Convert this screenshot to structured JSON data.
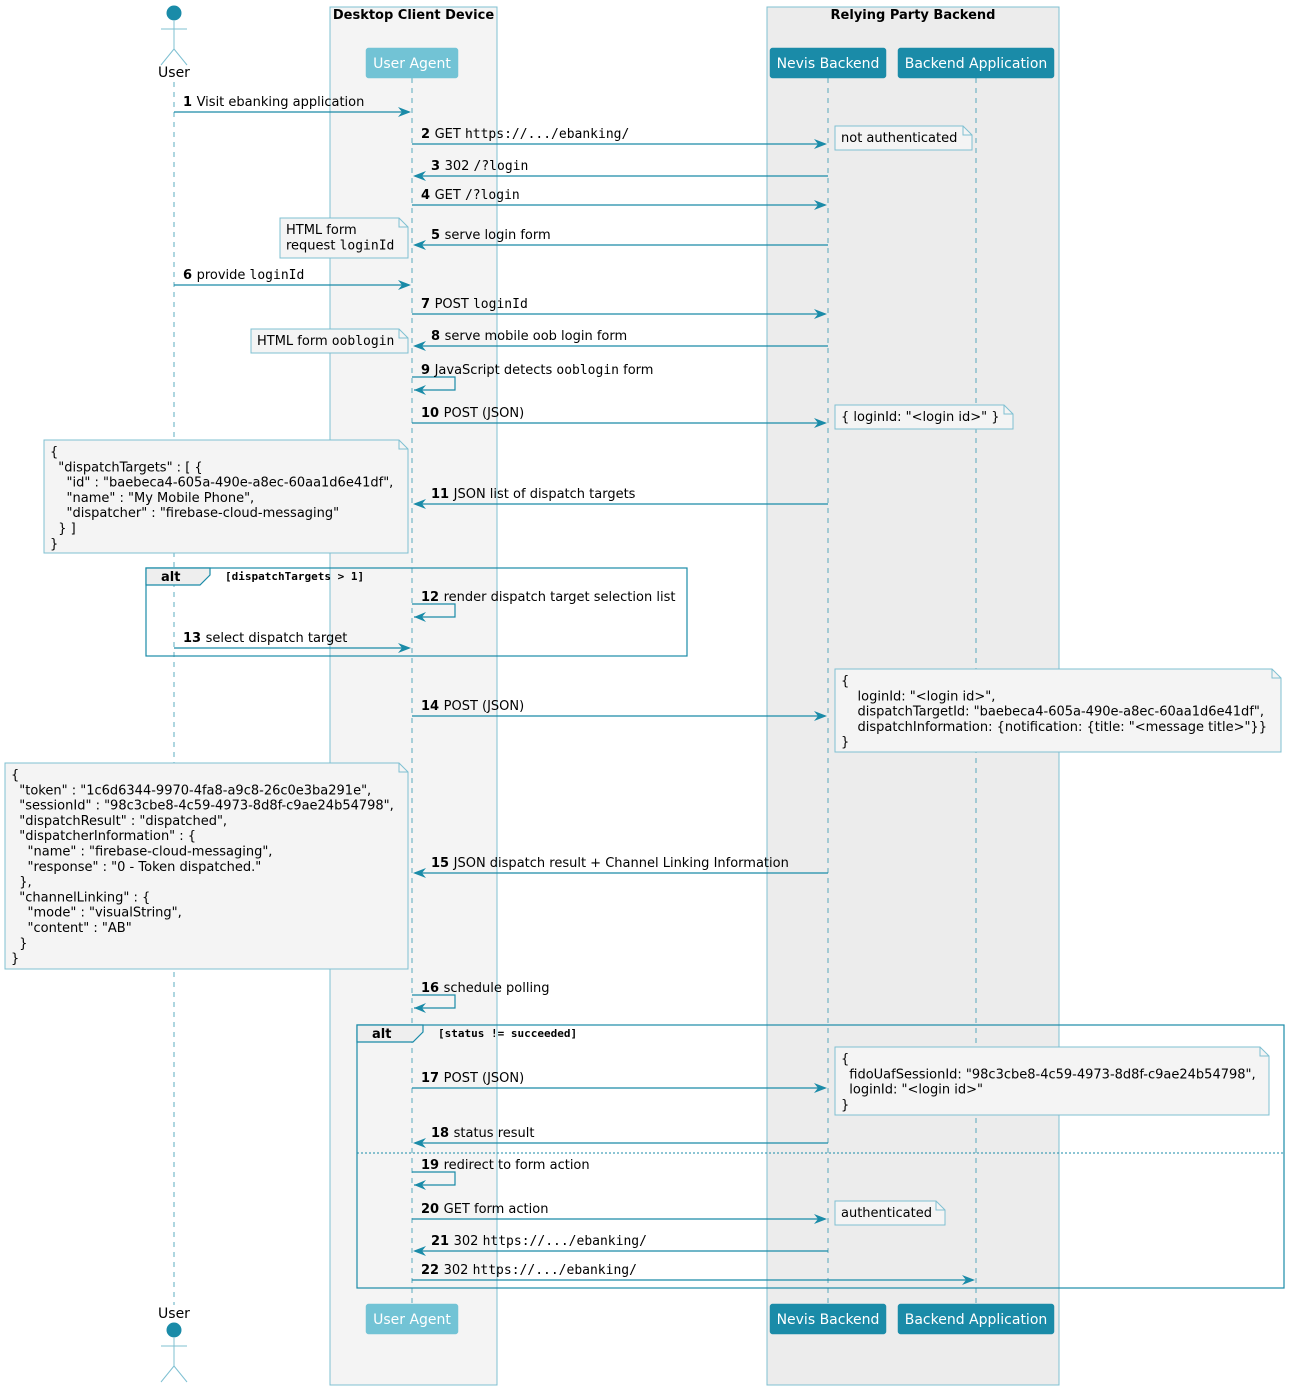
{
  "colors": {
    "line": "#1a8ba8",
    "box_border": "#7fc0d2",
    "desktop_box_fill": "#f4f4f4",
    "backend_box_fill": "#ececec",
    "user_agent_fill": "#72c3d5",
    "backend_fill": "#1a8ba8",
    "note_fill": "#f4f4f4",
    "note_border": "#7fc0d2",
    "actor_head": "#1a8ba8"
  },
  "boxes": [
    {
      "id": "desktop",
      "title": "Desktop Client Device"
    },
    {
      "id": "backend",
      "title": "Relying Party Backend"
    }
  ],
  "participants": [
    {
      "id": "user",
      "label": "User",
      "kind": "actor"
    },
    {
      "id": "ua",
      "label": "User Agent",
      "kind": "participant",
      "style": "light"
    },
    {
      "id": "nevis",
      "label": "Nevis Backend",
      "kind": "participant",
      "style": "dark"
    },
    {
      "id": "app",
      "label": "Backend Application",
      "kind": "participant",
      "style": "dark"
    }
  ],
  "messages": [
    {
      "n": "1",
      "from": "user",
      "to": "ua",
      "parts": [
        [
          "t",
          "Visit ebanking application"
        ]
      ]
    },
    {
      "n": "2",
      "from": "ua",
      "to": "nevis",
      "parts": [
        [
          "t",
          "GET "
        ],
        [
          "m",
          "https://.../ebanking/"
        ]
      ]
    },
    {
      "n": "3",
      "from": "nevis",
      "to": "ua",
      "parts": [
        [
          "t",
          "302 "
        ],
        [
          "m",
          "/?login"
        ]
      ]
    },
    {
      "n": "4",
      "from": "ua",
      "to": "nevis",
      "parts": [
        [
          "t",
          "GET "
        ],
        [
          "m",
          "/?login"
        ]
      ]
    },
    {
      "n": "5",
      "from": "nevis",
      "to": "ua",
      "parts": [
        [
          "t",
          "serve login form"
        ]
      ]
    },
    {
      "n": "6",
      "from": "user",
      "to": "ua",
      "parts": [
        [
          "t",
          "provide "
        ],
        [
          "m",
          "loginId"
        ]
      ]
    },
    {
      "n": "7",
      "from": "ua",
      "to": "nevis",
      "parts": [
        [
          "t",
          "POST "
        ],
        [
          "m",
          "loginId"
        ]
      ]
    },
    {
      "n": "8",
      "from": "nevis",
      "to": "ua",
      "parts": [
        [
          "t",
          "serve mobile oob login form"
        ]
      ]
    },
    {
      "n": "9",
      "from": "ua",
      "to": "ua",
      "parts": [
        [
          "t",
          "JavaScript detects "
        ],
        [
          "m",
          "ooblogin"
        ],
        [
          "t",
          " form"
        ]
      ]
    },
    {
      "n": "10",
      "from": "ua",
      "to": "nevis",
      "parts": [
        [
          "t",
          "POST (JSON)"
        ]
      ]
    },
    {
      "n": "11",
      "from": "nevis",
      "to": "ua",
      "parts": [
        [
          "t",
          "JSON list of dispatch targets"
        ]
      ]
    },
    {
      "n": "12",
      "from": "ua",
      "to": "ua",
      "parts": [
        [
          "t",
          "render dispatch target selection list"
        ]
      ]
    },
    {
      "n": "13",
      "from": "user",
      "to": "ua",
      "parts": [
        [
          "t",
          "select dispatch target"
        ]
      ]
    },
    {
      "n": "14",
      "from": "ua",
      "to": "nevis",
      "parts": [
        [
          "t",
          "POST (JSON)"
        ]
      ]
    },
    {
      "n": "15",
      "from": "nevis",
      "to": "ua",
      "parts": [
        [
          "t",
          "JSON dispatch result + Channel Linking Information"
        ]
      ]
    },
    {
      "n": "16",
      "from": "ua",
      "to": "ua",
      "parts": [
        [
          "t",
          "schedule polling"
        ]
      ]
    },
    {
      "n": "17",
      "from": "ua",
      "to": "nevis",
      "parts": [
        [
          "t",
          "POST (JSON)"
        ]
      ]
    },
    {
      "n": "18",
      "from": "nevis",
      "to": "ua",
      "parts": [
        [
          "t",
          "status result"
        ]
      ]
    },
    {
      "n": "19",
      "from": "ua",
      "to": "ua",
      "parts": [
        [
          "t",
          "redirect to form action"
        ]
      ]
    },
    {
      "n": "20",
      "from": "ua",
      "to": "nevis",
      "parts": [
        [
          "t",
          "GET form action"
        ]
      ]
    },
    {
      "n": "21",
      "from": "nevis",
      "to": "ua",
      "parts": [
        [
          "t",
          "302 "
        ],
        [
          "m",
          "https://.../ebanking/"
        ]
      ]
    },
    {
      "n": "22",
      "from": "ua",
      "to": "app",
      "parts": [
        [
          "t",
          "302 "
        ],
        [
          "m",
          "https://.../ebanking/"
        ]
      ]
    }
  ],
  "notes": [
    {
      "id": "note-not-authenticated",
      "at_message": "2",
      "side": "right",
      "lines": [
        [
          [
            "t",
            "not authenticated"
          ]
        ]
      ]
    },
    {
      "id": "note-html-form-loginid",
      "at_message": "5",
      "side": "left",
      "lines": [
        [
          [
            "t",
            "HTML form"
          ]
        ],
        [
          [
            "t",
            "request "
          ],
          [
            "m",
            "loginId"
          ]
        ]
      ]
    },
    {
      "id": "note-html-form-ooblogin",
      "at_message": "8",
      "side": "left",
      "lines": [
        [
          [
            "t",
            "HTML form "
          ],
          [
            "m",
            "ooblogin"
          ]
        ]
      ]
    },
    {
      "id": "note-loginid-json",
      "at_message": "10",
      "side": "right",
      "lines": [
        [
          [
            "t",
            "{ loginId: \"<login id>\" }"
          ]
        ]
      ]
    },
    {
      "id": "note-dispatch-targets",
      "at_message": "11",
      "side": "left",
      "lines": [
        [
          [
            "t",
            "{"
          ]
        ],
        [
          [
            "t",
            "  \"dispatchTargets\" : [ {"
          ]
        ],
        [
          [
            "t",
            "    \"id\" : \"baebeca4-605a-490e-a8ec-60aa1d6e41df\","
          ]
        ],
        [
          [
            "t",
            "    \"name\" : \"My Mobile Phone\","
          ]
        ],
        [
          [
            "t",
            "    \"dispatcher\" : \"firebase-cloud-messaging\""
          ]
        ],
        [
          [
            "t",
            "  } ]"
          ]
        ],
        [
          [
            "t",
            "}"
          ]
        ]
      ]
    },
    {
      "id": "note-dispatch-request",
      "at_message": "14",
      "side": "right",
      "lines": [
        [
          [
            "t",
            "{"
          ]
        ],
        [
          [
            "t",
            "    loginId: \"<login id>\","
          ]
        ],
        [
          [
            "t",
            "    dispatchTargetId: \"baebeca4-605a-490e-a8ec-60aa1d6e41df\","
          ]
        ],
        [
          [
            "t",
            "    dispatchInformation: {notification: {title: \"<message title>\"}}"
          ]
        ],
        [
          [
            "t",
            "}"
          ]
        ]
      ]
    },
    {
      "id": "note-dispatch-result",
      "at_message": "15",
      "side": "left",
      "lines": [
        [
          [
            "t",
            "{"
          ]
        ],
        [
          [
            "t",
            "  \"token\" : \"1c6d6344-9970-4fa8-a9c8-26c0e3ba291e\","
          ]
        ],
        [
          [
            "t",
            "  \"sessionId\" : \"98c3cbe8-4c59-4973-8d8f-c9ae24b54798\","
          ]
        ],
        [
          [
            "t",
            "  \"dispatchResult\" : \"dispatched\","
          ]
        ],
        [
          [
            "t",
            "  \"dispatcherInformation\" : {"
          ]
        ],
        [
          [
            "t",
            "    \"name\" : \"firebase-cloud-messaging\","
          ]
        ],
        [
          [
            "t",
            "    \"response\" : \"0 - Token dispatched.\""
          ]
        ],
        [
          [
            "t",
            "  },"
          ]
        ],
        [
          [
            "t",
            "  \"channelLinking\" : {"
          ]
        ],
        [
          [
            "t",
            "    \"mode\" : \"visualString\","
          ]
        ],
        [
          [
            "t",
            "    \"content\" : \"AB\""
          ]
        ],
        [
          [
            "t",
            "  }"
          ]
        ],
        [
          [
            "t",
            "}"
          ]
        ]
      ]
    },
    {
      "id": "note-status-request",
      "at_message": "17",
      "side": "right",
      "lines": [
        [
          [
            "t",
            "{"
          ]
        ],
        [
          [
            "t",
            "  fidoUafSessionId: \"98c3cbe8-4c59-4973-8d8f-c9ae24b54798\","
          ]
        ],
        [
          [
            "t",
            "  loginId: \"<login id>\""
          ]
        ],
        [
          [
            "t",
            "}"
          ]
        ]
      ]
    },
    {
      "id": "note-authenticated",
      "at_message": "20",
      "side": "right",
      "lines": [
        [
          [
            "t",
            "authenticated"
          ]
        ]
      ]
    }
  ],
  "fragments": [
    {
      "id": "alt-dispatch-targets",
      "label": "alt",
      "guard": "[dispatchTargets >  1]",
      "from_message": "12",
      "to_message": "13"
    },
    {
      "id": "alt-status",
      "label": "alt",
      "guard": "[status != succeeded]",
      "from_message": "17",
      "to_message": "22",
      "else_after_message": "18"
    }
  ]
}
